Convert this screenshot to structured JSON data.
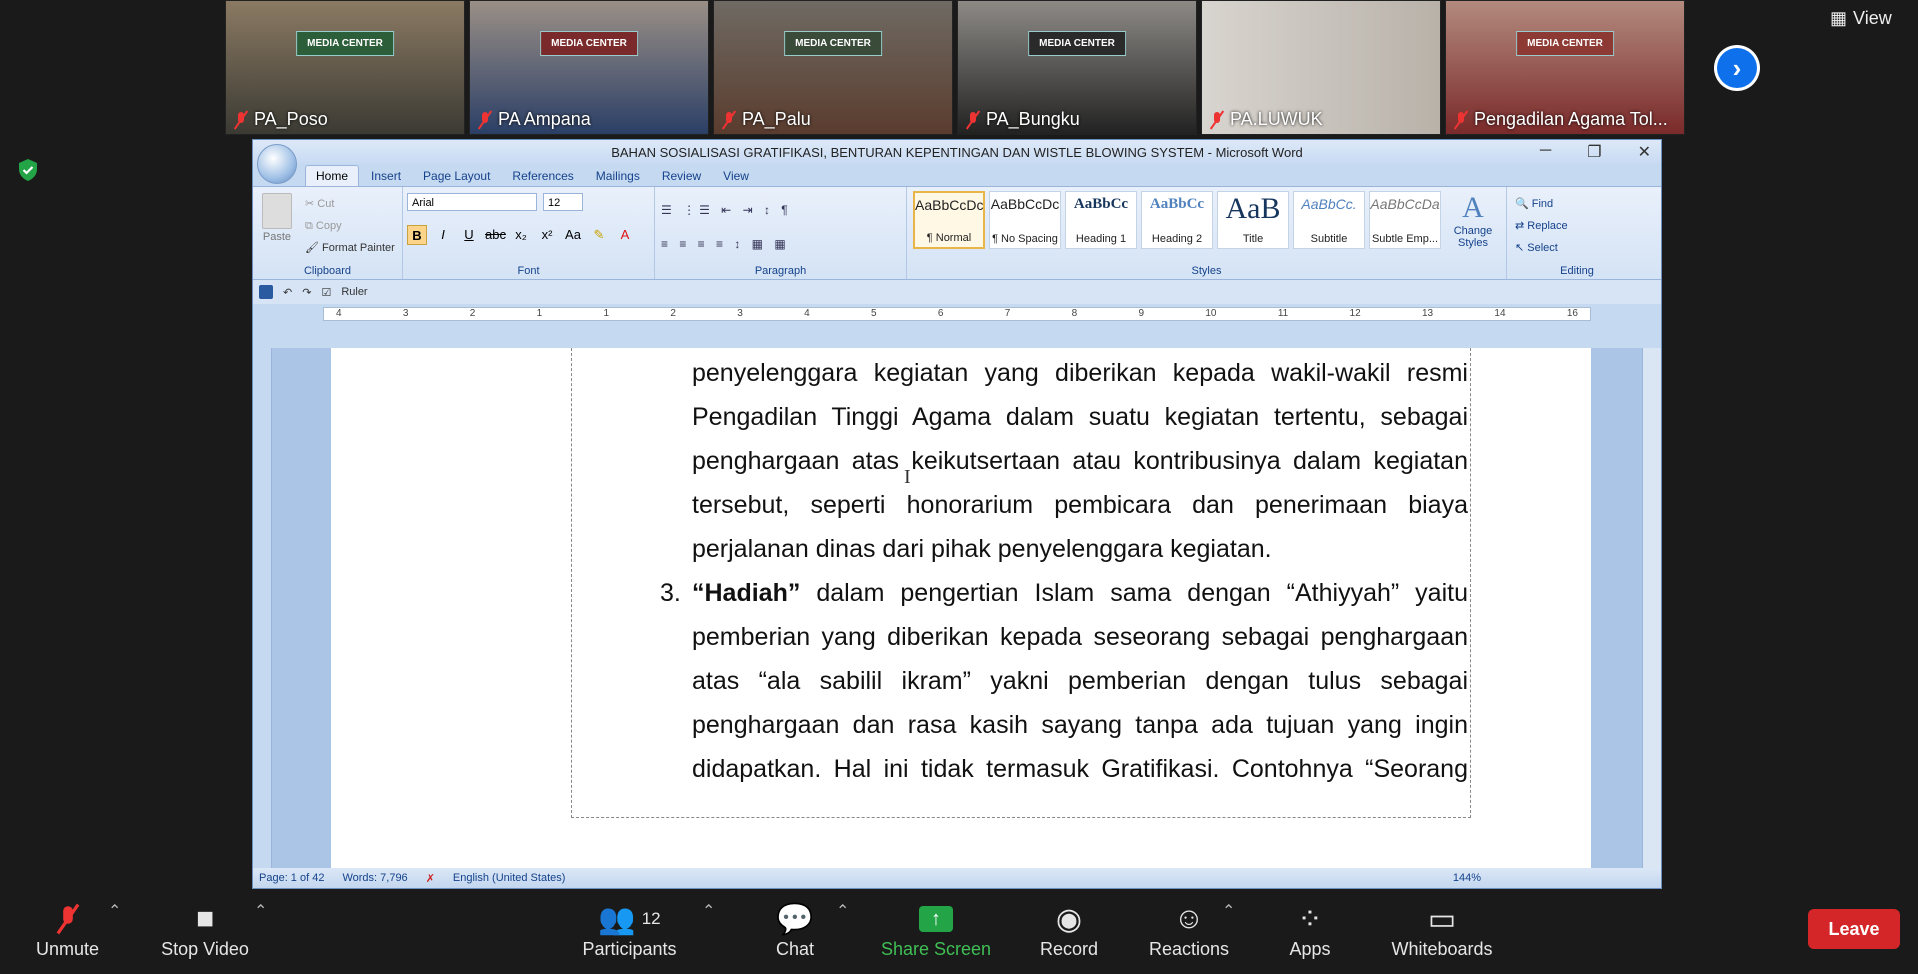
{
  "participants_strip": [
    {
      "name": "PA_Poso",
      "banner": "MEDIA CENTER",
      "bg": "#6f6152"
    },
    {
      "name": "PA Ampana",
      "banner": "MEDIA CENTER",
      "bg": "#5f6675"
    },
    {
      "name": "PA_Palu",
      "banner": "MEDIA CENTER",
      "bg": "#6a5f55"
    },
    {
      "name": "PA_Bungku",
      "banner": "MEDIA CENTER",
      "bg": "#3f3b36"
    },
    {
      "name": "PA.LUWUK",
      "banner": "",
      "bg": "#c9c5c0"
    },
    {
      "name": "Pengadilan Agama Tol...",
      "banner": "MEDIA CENTER",
      "bg": "#8a5c52"
    }
  ],
  "view_label": "View",
  "word": {
    "title": "BAHAN SOSIALISASI GRATIFIKASI, BENTURAN KEPENTINGAN DAN WISTLE BLOWING SYSTEM - Microsoft Word",
    "tabs": [
      "Home",
      "Insert",
      "Page Layout",
      "References",
      "Mailings",
      "Review",
      "View"
    ],
    "clipboard": {
      "paste": "Paste",
      "cut": "Cut",
      "copy": "Copy",
      "format_painter": "Format Painter",
      "label": "Clipboard"
    },
    "font": {
      "name": "Arial",
      "size": "12",
      "label": "Font"
    },
    "paragraph_label": "Paragraph",
    "styles": [
      {
        "sample": "AaBbCcDc",
        "name": "¶ Normal"
      },
      {
        "sample": "AaBbCcDc",
        "name": "¶ No Spacing"
      },
      {
        "sample": "AaBbCc",
        "name": "Heading 1"
      },
      {
        "sample": "AaBbCc",
        "name": "Heading 2"
      },
      {
        "sample": "AaB",
        "name": "Title"
      },
      {
        "sample": "AaBbCc.",
        "name": "Subtitle"
      },
      {
        "sample": "AaBbCcDa",
        "name": "Subtle Emp..."
      }
    ],
    "change_styles": "Change Styles",
    "styles_label": "Styles",
    "editing": {
      "find": "Find",
      "replace": "Replace",
      "select": "Select",
      "label": "Editing"
    },
    "qat_ruler": "Ruler",
    "ruler_ticks": [
      "4",
      "3",
      "2",
      "1",
      "1",
      "2",
      "3",
      "4",
      "5",
      "6",
      "7",
      "8",
      "9",
      "10",
      "11",
      "12",
      "13",
      "14",
      "16"
    ],
    "doc": {
      "para1": "penyelenggara kegiatan yang diberikan kepada wakil-wakil resmi Pengadilan Tinggi Agama dalam suatu kegiatan tertentu, sebagai penghargaan atas keikutsertaan atau kontribusinya dalam kegiatan tersebut, seperti honorarium pembicara dan penerimaan biaya",
      "para1_last": "perjalanan dinas dari pihak penyelenggara kegiatan.",
      "num": "3.",
      "bold": "“Hadiah”",
      "para2": " dalam pengertian Islam  sama dengan “Athiyyah” yaitu pemberian yang diberikan kepada seseorang sebagai penghargaan atas “ala sabilil ikram” yakni pemberian  dengan tulus sebagai penghargaan dan rasa kasih sayang tanpa ada tujuan yang ingin didapatkan. Hal ini tidak termasuk Gratifikasi. Contohnya “Seorang"
    },
    "status": {
      "page": "Page: 1 of 42",
      "words": "Words: 7,796",
      "lang": "English (United States)",
      "zoom": "144%"
    }
  },
  "toolbar": {
    "unmute": "Unmute",
    "stop_video": "Stop Video",
    "participants": "Participants",
    "participants_count": "12",
    "chat": "Chat",
    "share": "Share Screen",
    "record": "Record",
    "reactions": "Reactions",
    "apps": "Apps",
    "whiteboards": "Whiteboards",
    "leave": "Leave"
  }
}
